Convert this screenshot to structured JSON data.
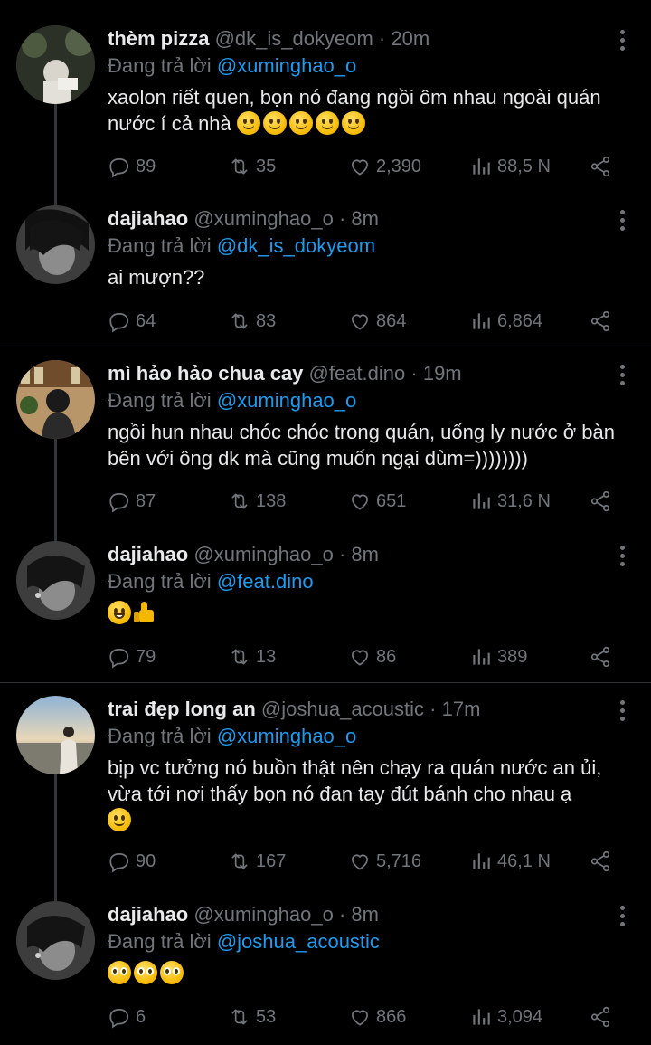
{
  "colors": {
    "background": "#000000",
    "text": "#e7e9ea",
    "muted": "#71767b",
    "link": "#1d9bf0",
    "divider": "#2f3336"
  },
  "tweets": [
    {
      "name": "thèm pizza",
      "handle": "@dk_is_dokyeom",
      "time": "· 20m",
      "reply_prefix": "Đang trả lời",
      "reply_to": "@xuminghao_o",
      "text": "xaolon riết quen, bọn nó đang ngồi ôm nhau ngoài quán nước í cả nhà",
      "emoji": [
        "slightly-smiling-face",
        "slightly-smiling-face",
        "slightly-smiling-face",
        "slightly-smiling-face",
        "slightly-smiling-face"
      ],
      "replies": "89",
      "retweets": "35",
      "likes": "2,390",
      "views": "88,5 N"
    },
    {
      "name": "dajiahao",
      "handle": "@xuminghao_o",
      "time": "· 8m",
      "reply_prefix": "Đang trả lời",
      "reply_to": "@dk_is_dokyeom",
      "text": "ai mượn??",
      "emoji": [],
      "replies": "64",
      "retweets": "83",
      "likes": "864",
      "views": "6,864"
    },
    {
      "name": "mì hảo hảo chua cay",
      "handle": "@feat.dino",
      "time": "· 19m",
      "reply_prefix": "Đang trả lời",
      "reply_to": "@xuminghao_o",
      "text": "ngồi hun nhau chóc chóc trong quán, uống ly nước ở bàn bên với ông dk mà cũng muốn ngại dùm=))))))))",
      "emoji": [],
      "replies": "87",
      "retweets": "138",
      "likes": "651",
      "views": "31,6 N"
    },
    {
      "name": "dajiahao",
      "handle": "@xuminghao_o",
      "time": "· 8m",
      "reply_prefix": "Đang trả lời",
      "reply_to": "@feat.dino",
      "text": "",
      "emoji": [
        "grinning-face",
        "thumbs-up"
      ],
      "replies": "79",
      "retweets": "13",
      "likes": "86",
      "views": "389"
    },
    {
      "name": "trai đẹp long an",
      "handle": "@joshua_acoustic",
      "time": "· 17m",
      "reply_prefix": "Đang trả lời",
      "reply_to": "@xuminghao_o",
      "text": "bịp vc tưởng nó buồn thật nên chạy ra quán nước an ủi, vừa tới nơi thấy bọn nó đan tay đút bánh cho nhau ạ",
      "emoji": [
        "slightly-smiling-face"
      ],
      "replies": "90",
      "retweets": "167",
      "likes": "5,716",
      "views": "46,1 N"
    },
    {
      "name": "dajiahao",
      "handle": "@xuminghao_o",
      "time": "· 8m",
      "reply_prefix": "Đang trả lời",
      "reply_to": "@joshua_acoustic",
      "text": "",
      "emoji": [
        "pleading-face",
        "pleading-face",
        "pleading-face"
      ],
      "replies": "6",
      "retweets": "53",
      "likes": "866",
      "views": "3,094"
    }
  ]
}
